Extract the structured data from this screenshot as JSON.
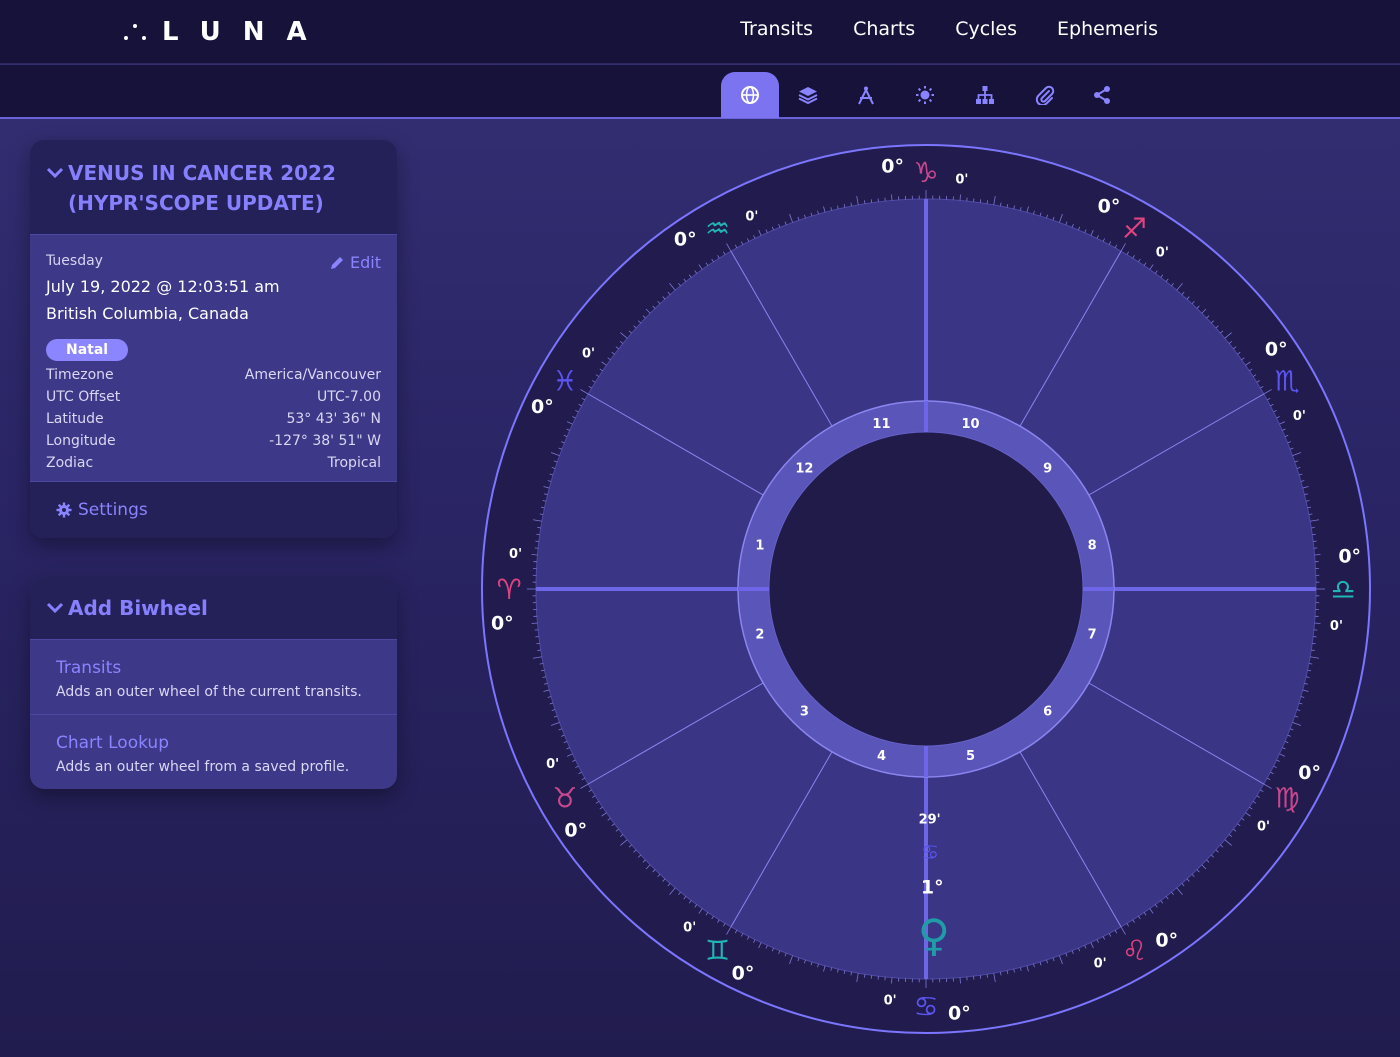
{
  "app": {
    "logo_text": "LUNA",
    "nav": [
      "Transits",
      "Charts",
      "Cycles",
      "Ephemeris"
    ]
  },
  "toolbar": {
    "icons": [
      "globe-icon",
      "layers-icon",
      "compass-icon",
      "sun-icon",
      "sitemap-icon",
      "paperclip-icon",
      "share-icon"
    ],
    "active": "globe-icon"
  },
  "chart_card": {
    "title": "VENUS IN CANCER 2022 (HYPR'SCOPE UPDATE)",
    "edit_label": "Edit",
    "weekday": "Tuesday",
    "datetime": "July 19, 2022 @ 12:03:51 am",
    "place": "British Columbia, Canada",
    "badge": "Natal",
    "details": [
      {
        "label": "Timezone",
        "value": "America/Vancouver"
      },
      {
        "label": "UTC Offset",
        "value": "UTC-7.00"
      },
      {
        "label": "Latitude",
        "value": "53° 43' 36\" N"
      },
      {
        "label": "Longitude",
        "value": "-127° 38' 51\" W"
      },
      {
        "label": "Zodiac",
        "value": "Tropical"
      }
    ],
    "settings_label": "Settings"
  },
  "biwheel_card": {
    "title": "Add Biwheel",
    "options": [
      {
        "title": "Transits",
        "desc": "Adds an outer wheel of the current transits."
      },
      {
        "title": "Chart Lookup",
        "desc": "Adds an outer wheel from a saved profile."
      }
    ]
  },
  "wheel": {
    "colors": {
      "outer_ring": "#211c4d",
      "inner_area": "#3a3585",
      "house_ring": "#5a55b8",
      "center": "#201b48",
      "line": "#7c76ff",
      "pink": "#e0437f",
      "teal": "#22b5b5",
      "blue": "#5b54f0",
      "magenta": "#c8478f"
    },
    "signs": [
      {
        "glyph": "♑",
        "name": "capricorn-icon",
        "color": "#c8478f",
        "deg": "0°",
        "min": "0'"
      },
      {
        "glyph": "♐",
        "name": "sagittarius-icon",
        "color": "#e0437f",
        "deg": "0°",
        "min": "0'"
      },
      {
        "glyph": "♏",
        "name": "scorpio-icon",
        "color": "#5b54f0",
        "deg": "0°",
        "min": "0'"
      },
      {
        "glyph": "♎",
        "name": "libra-icon",
        "color": "#22b5b5",
        "deg": "0°",
        "min": "0'"
      },
      {
        "glyph": "♍",
        "name": "virgo-icon",
        "color": "#c8478f",
        "deg": "0°",
        "min": "0'"
      },
      {
        "glyph": "♌",
        "name": "leo-icon",
        "color": "#e0437f",
        "deg": "0°",
        "min": "0'"
      },
      {
        "glyph": "♋",
        "name": "cancer-icon",
        "color": "#5b54f0",
        "deg": "0°",
        "min": "0'"
      },
      {
        "glyph": "♊",
        "name": "gemini-icon",
        "color": "#22b5b5",
        "deg": "0°",
        "min": "0'"
      },
      {
        "glyph": "♉",
        "name": "taurus-icon",
        "color": "#c8478f",
        "deg": "0°",
        "min": "0'"
      },
      {
        "glyph": "♈",
        "name": "aries-icon",
        "color": "#e0437f",
        "deg": "0°",
        "min": "0'"
      },
      {
        "glyph": "♓",
        "name": "pisces-icon",
        "color": "#5b54f0",
        "deg": "0°",
        "min": "0'"
      },
      {
        "glyph": "♒",
        "name": "aquarius-icon",
        "color": "#22b5b5",
        "deg": "0°",
        "min": "0'"
      }
    ],
    "houses": [
      "10",
      "9",
      "8",
      "7",
      "6",
      "5",
      "4",
      "3",
      "2",
      "1",
      "12",
      "11"
    ],
    "planet": {
      "name": "venus-icon",
      "glyph": "♀",
      "sign_glyph": "♋",
      "deg": "1°",
      "min": "29'",
      "color": "#1f9ca8"
    }
  }
}
